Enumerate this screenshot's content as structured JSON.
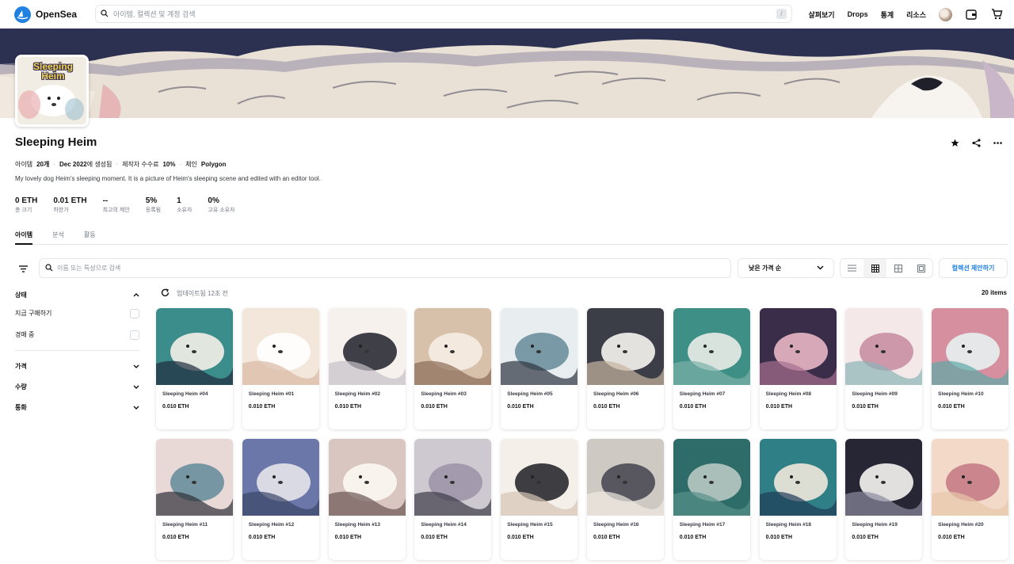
{
  "header": {
    "logo_text": "OpenSea",
    "search_placeholder": "아이템, 컬렉션 및 계정 검색",
    "search_shortcut": "/",
    "nav": [
      "살펴보기",
      "Drops",
      "통계",
      "리소스"
    ]
  },
  "collection": {
    "title": "Sleeping Heim",
    "profile_text": "Sleeping Heim",
    "meta": {
      "items_prefix": "아이템",
      "items_count": "20개",
      "created_date": "Dec 2022",
      "created_suffix": "에 생성됨",
      "fee_prefix": "제작자 수수료",
      "fee_value": "10%",
      "chain_prefix": "체인",
      "chain_value": "Polygon"
    },
    "description": "My lovely dog Heim's sleeping moment. It is a picture of Heim's sleeping scene and edited with an editor tool."
  },
  "stats": [
    {
      "value": "0 ETH",
      "label": "총 크기"
    },
    {
      "value": "0.01 ETH",
      "label": "하한가"
    },
    {
      "value": "--",
      "label": "최고의 제안"
    },
    {
      "value": "5%",
      "label": "등록됨"
    },
    {
      "value": "1",
      "label": "소유자"
    },
    {
      "value": "0%",
      "label": "고유 소유자"
    }
  ],
  "tabs": [
    "아이템",
    "분석",
    "활동"
  ],
  "toolbar": {
    "search_placeholder": "이름 또는 특성으로 검색",
    "sort_label": "낮은 가격 순",
    "offer_button": "컬렉션 제안하기"
  },
  "sidebar": {
    "status_title": "상태",
    "status_options": [
      "지금 구매하기",
      "경매 중"
    ],
    "sections": [
      "가격",
      "수량",
      "통화"
    ]
  },
  "listing": {
    "updated_text": "업데이트됨 12초 전",
    "count_text": "20 items",
    "items": [
      {
        "name": "Sleeping Heim #04",
        "price": "0.010 ETH"
      },
      {
        "name": "Sleeping Heim #01",
        "price": "0.010 ETH"
      },
      {
        "name": "Sleeping Heim #02",
        "price": "0.010 ETH"
      },
      {
        "name": "Sleeping Heim #03",
        "price": "0.010 ETH"
      },
      {
        "name": "Sleeping Heim #05",
        "price": "0.010 ETH"
      },
      {
        "name": "Sleeping Heim #06",
        "price": "0.010 ETH"
      },
      {
        "name": "Sleeping Heim #07",
        "price": "0.010 ETH"
      },
      {
        "name": "Sleeping Heim #08",
        "price": "0.010 ETH"
      },
      {
        "name": "Sleeping Heim #09",
        "price": "0.010 ETH"
      },
      {
        "name": "Sleeping Heim #10",
        "price": "0.010 ETH"
      },
      {
        "name": "Sleeping Heim #11",
        "price": "0.010 ETH"
      },
      {
        "name": "Sleeping Heim #12",
        "price": "0.010 ETH"
      },
      {
        "name": "Sleeping Heim #13",
        "price": "0.010 ETH"
      },
      {
        "name": "Sleeping Heim #14",
        "price": "0.010 ETH"
      },
      {
        "name": "Sleeping Heim #15",
        "price": "0.010 ETH"
      },
      {
        "name": "Sleeping Heim #16",
        "price": "0.010 ETH"
      },
      {
        "name": "Sleeping Heim #17",
        "price": "0.010 ETH"
      },
      {
        "name": "Sleeping Heim #18",
        "price": "0.010 ETH"
      },
      {
        "name": "Sleeping Heim #19",
        "price": "0.010 ETH"
      },
      {
        "name": "Sleeping Heim #20",
        "price": "0.010 ETH"
      }
    ]
  },
  "colors": {
    "accent": "#2081e2",
    "text": "#121212",
    "muted": "#707a83",
    "border": "#e5e8eb"
  }
}
